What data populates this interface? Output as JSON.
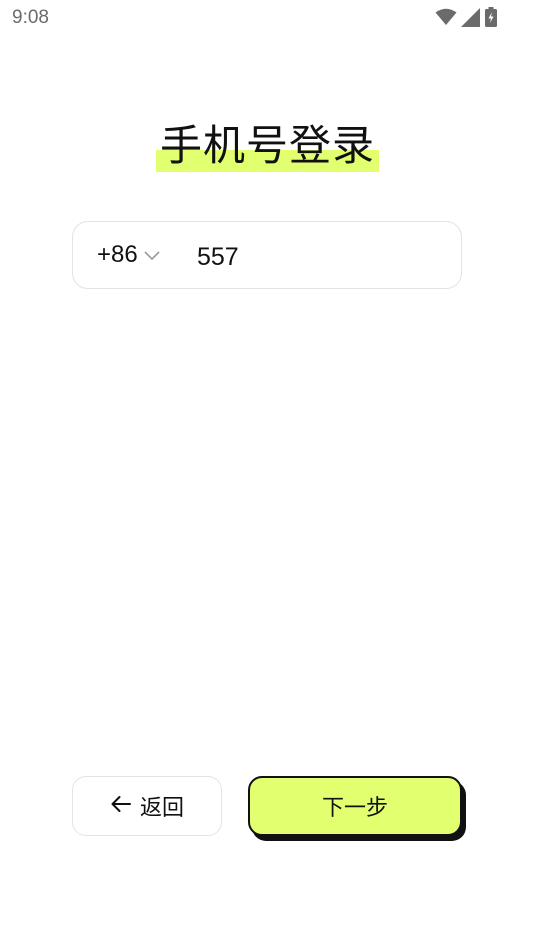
{
  "status_bar": {
    "time": "9:08",
    "icons": [
      "wifi-icon",
      "signal-icon",
      "battery-charging-icon"
    ]
  },
  "page": {
    "title": "手机号登录",
    "accent_color": "#e1ff6e"
  },
  "phone_field": {
    "country_code": "+86",
    "value": "557"
  },
  "buttons": {
    "back_label": "返回",
    "next_label": "下一步"
  }
}
